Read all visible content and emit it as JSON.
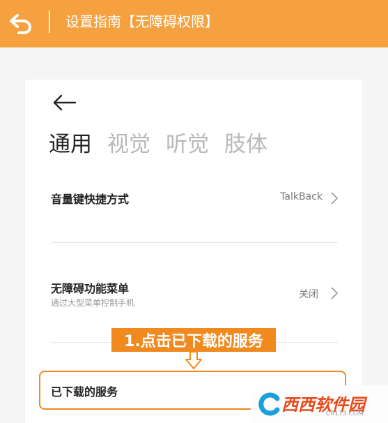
{
  "header": {
    "title": "设置指南【无障碍权限】",
    "background_color": "#f6a13f",
    "back_icon": "undo-arrow-icon"
  },
  "card": {
    "back_icon": "arrow-left-icon",
    "tabs": [
      {
        "label": "通用",
        "active": true
      },
      {
        "label": "视觉",
        "active": false
      },
      {
        "label": "听觉",
        "active": false
      },
      {
        "label": "肢体",
        "active": false
      }
    ],
    "settings": [
      {
        "label": "音量键快捷方式",
        "value": "TalkBack"
      },
      {
        "label": "无障碍功能菜单",
        "subtitle": "通过大型菜单控制手机",
        "value": "关闭"
      },
      {
        "label": "已下载的服务"
      }
    ]
  },
  "annotation": {
    "text": "1.点击已下载的服务",
    "color": "#f08a1f"
  },
  "watermark": {
    "text": "西西软件园",
    "sub": "CR173.COM",
    "color": "#e74a1b"
  }
}
